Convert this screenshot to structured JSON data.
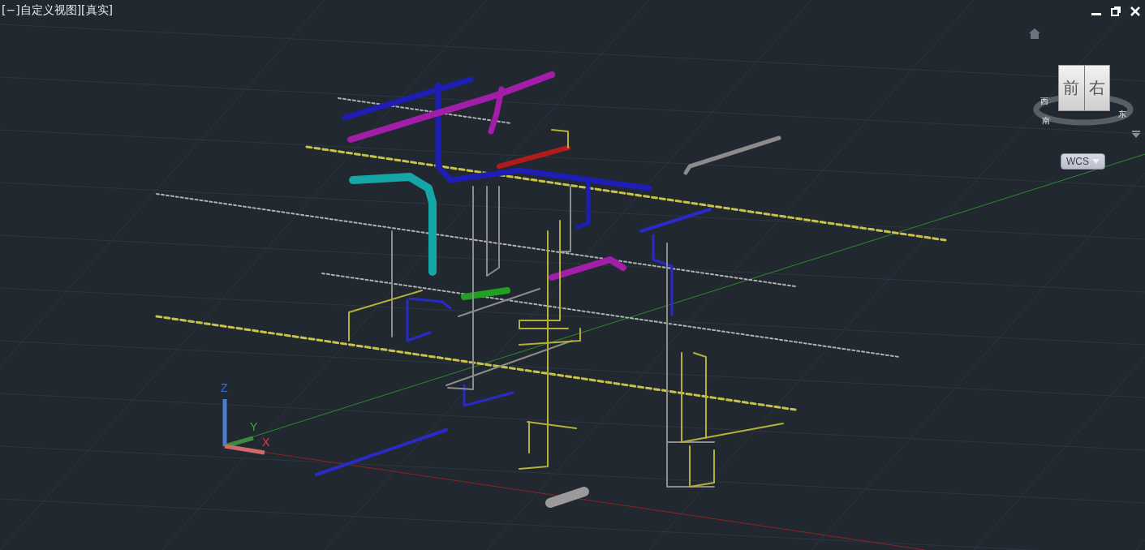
{
  "viewport": {
    "title": "[−]自定义视图][真实]"
  },
  "window_controls": [
    {
      "kind": "minimize"
    },
    {
      "kind": "restore"
    },
    {
      "kind": "close"
    }
  ],
  "viewcube": {
    "faces": [
      "前",
      "右"
    ],
    "compass": [
      "西",
      "南",
      "东"
    ]
  },
  "ucs_menu": {
    "label": "WCS"
  },
  "ucs_icon": {
    "axes": [
      "X",
      "Y",
      "Z"
    ]
  }
}
